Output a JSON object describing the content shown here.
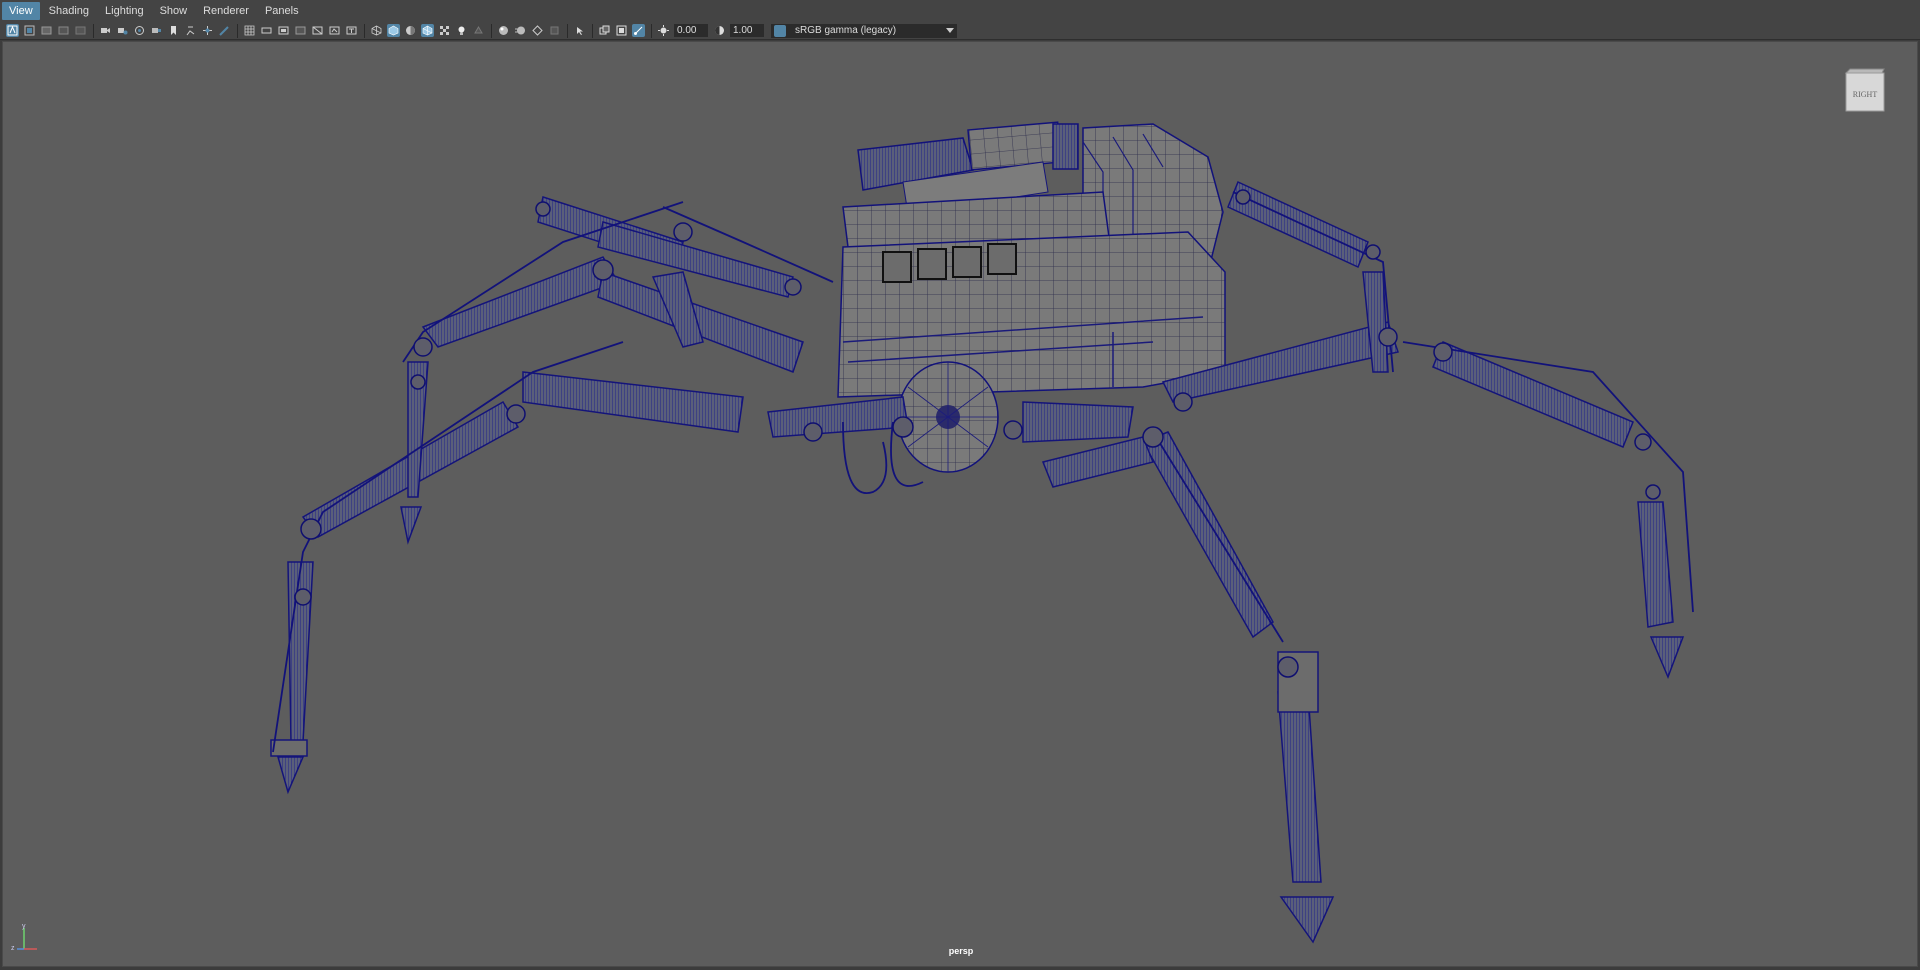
{
  "menubar": {
    "items": [
      {
        "label": "View",
        "active": true
      },
      {
        "label": "Shading",
        "active": false
      },
      {
        "label": "Lighting",
        "active": false
      },
      {
        "label": "Show",
        "active": false
      },
      {
        "label": "Renderer",
        "active": false
      },
      {
        "label": "Panels",
        "active": false
      }
    ]
  },
  "toolbar": {
    "exposure_value": "0.00",
    "gamma_value": "1.00",
    "color_space": "sRGB gamma (legacy)",
    "accent_color": "#5285a6"
  },
  "viewport": {
    "camera_name": "persp",
    "viewcube_label": "RIGHT",
    "background_color": "#5d5d5d",
    "wire_color": "#1a1a8c",
    "axis_labels": {
      "x": "x",
      "y": "y",
      "z": "z"
    }
  }
}
